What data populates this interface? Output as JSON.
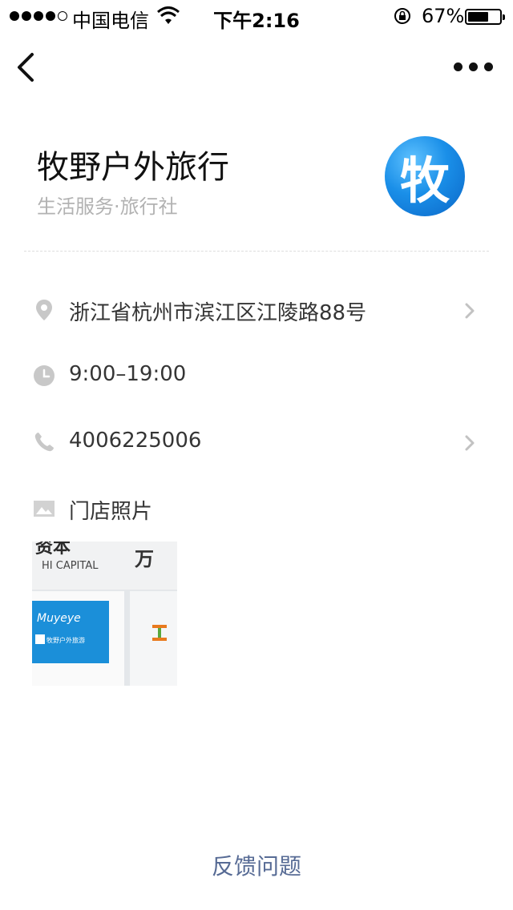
{
  "status_bar": {
    "carrier": "中国电信",
    "time": "下午2:16",
    "battery_percent": "67%",
    "battery_level": 0.67,
    "signal_bars": 4,
    "signal_total": 5
  },
  "nav": {
    "back_icon": "chevron-left-icon",
    "more_icon": "more-dots-icon"
  },
  "store": {
    "name": "牧野户外旅行",
    "category": "生活服务·旅行社",
    "logo_text": "牧",
    "logo_color": "#1a8fe8"
  },
  "details": {
    "address": "浙江省杭州市滨江区江陵路88号",
    "hours": "9:00–19:00",
    "phone": "4006225006",
    "photos_label": "门店照片"
  },
  "photo_overlay": {
    "top_left_text": "Muyeye",
    "sign_line": "牧野户外旅游",
    "wall_text_1": "资本",
    "wall_text_2": "HI CAPITAL",
    "wall_text_3": "万"
  },
  "footer": {
    "feedback_label": "反馈问题"
  },
  "colors": {
    "link": "#576b95",
    "icon_gray": "#c8c8c8",
    "accent_blue": "#1a8fe8"
  }
}
